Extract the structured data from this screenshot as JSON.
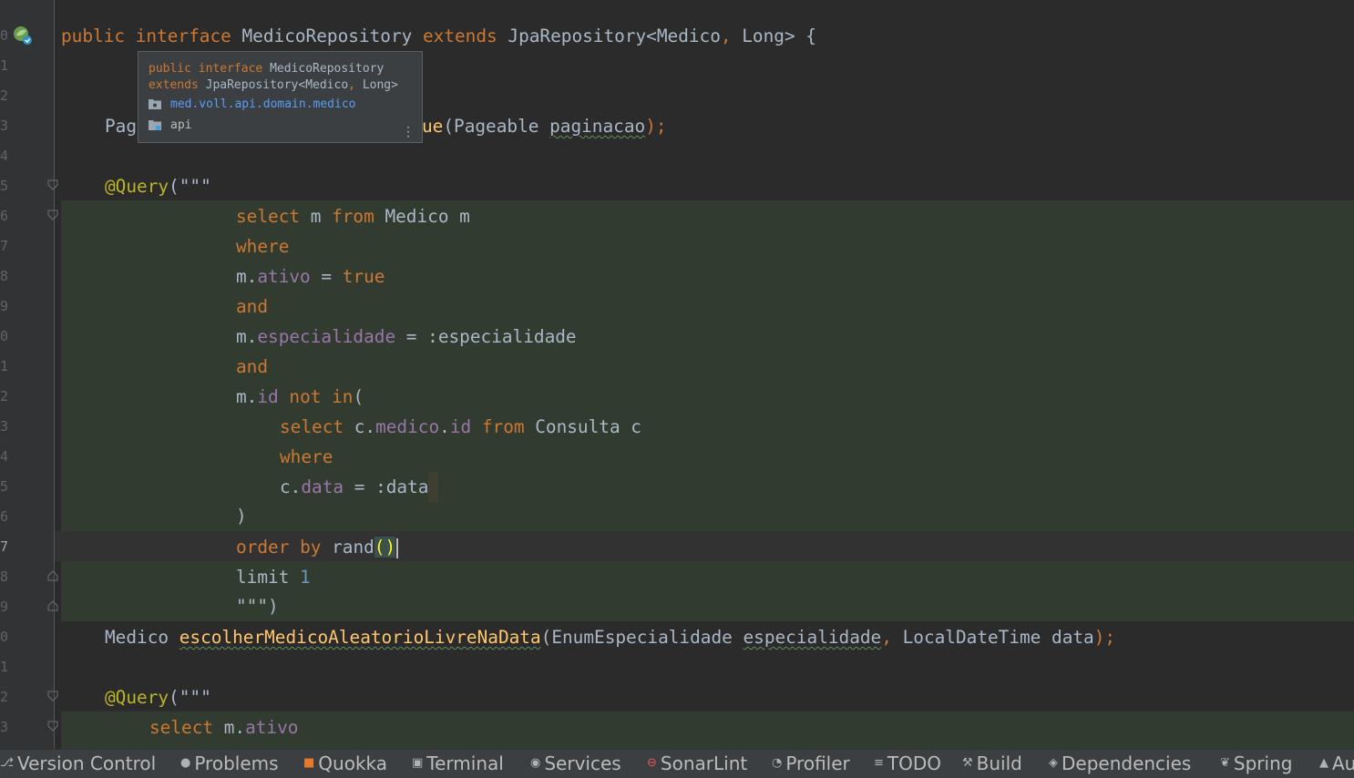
{
  "editor": {
    "line_number_digits": [
      "0",
      "1",
      "2",
      "3",
      "4",
      "5",
      "6",
      "7",
      "8",
      "9",
      "0",
      "1",
      "2",
      "3",
      "4",
      "5",
      "6",
      "7",
      "8",
      "9",
      "0",
      "1",
      "2",
      "3"
    ],
    "current_line_index": 17,
    "tokens": {
      "public": "public",
      "interface": "interface",
      "class_name": "MedicoRepository",
      "extends": "extends",
      "jpa_generic": "JpaRepository<Medico",
      "comma": ", ",
      "long_brace": "Long> {",
      "pag_prefix": "Pag",
      "method1_tail": "ue",
      "paren_pageable": "(Pageable ",
      "paginacao": "paginacao",
      "close_semicolon": ");",
      "query_annotation": "@Query",
      "triple_quote_open": "(\"\"\"",
      "select": "select",
      "m": " m ",
      "from": "from",
      "medico_m": " Medico m",
      "where": "where",
      "m_dot": "m.",
      "ativo": "ativo",
      "eq": " = ",
      "true_kw": "true",
      "and": "and",
      "especialidade_field": "especialidade",
      "especialidade_param": " = :especialidade",
      "id_field": "id",
      "not": " not ",
      "in": "in",
      "open_paren": "(",
      "c_dot": " c.",
      "medico_field": "medico",
      "dot": ".",
      "consulta_c": " Consulta c",
      "c_prefix": "c.",
      "data_field": "data",
      "data_param": " = :data",
      "close_paren": ")",
      "order": "order",
      "by": "by",
      "rand": " rand",
      "rand_parens": "()",
      "limit": "limit ",
      "one": "1",
      "triple_quote_close": "\"\"\")",
      "medico_type": "Medico ",
      "method2": "escolherMedicoAleatorioLivreNaData",
      "enum_param": "(EnumEspecialidade ",
      "especialidade_arg": "especialidade",
      "localdatetime": "LocalDateTime data",
      "select_m_ativo_select": "select",
      "m_ativo_prefix": " m.",
      "ativo2": "ativo"
    }
  },
  "popup": {
    "line1_public": "public",
    "line1_interface": "interface",
    "line1_name": "MedicoRepository",
    "line2_extends": "extends",
    "line2_rest": "JpaRepository<Medico",
    "line2_comma": ", ",
    "line2_long": "Long>",
    "package": "med.voll.api.domain.medico",
    "module": "api",
    "more_glyph": "⋮"
  },
  "toolwindow_bar": {
    "items": [
      {
        "label": "Version Control",
        "icon": "version-control-icon",
        "glyph": "⎇"
      },
      {
        "label": "Problems",
        "icon": "problems-icon",
        "glyph": "●"
      },
      {
        "label": "Quokka",
        "icon": "quokka-icon",
        "glyph": "■"
      },
      {
        "label": "Terminal",
        "icon": "terminal-icon",
        "glyph": "▣"
      },
      {
        "label": "Services",
        "icon": "services-icon",
        "glyph": "◉"
      },
      {
        "label": "SonarLint",
        "icon": "sonarlint-icon",
        "glyph": "⊖"
      },
      {
        "label": "Profiler",
        "icon": "profiler-icon",
        "glyph": "◔"
      },
      {
        "label": "TODO",
        "icon": "todo-icon",
        "glyph": "≡"
      },
      {
        "label": "Build",
        "icon": "build-icon",
        "glyph": "⚒"
      },
      {
        "label": "Dependencies",
        "icon": "dependencies-icon",
        "glyph": "◈"
      },
      {
        "label": "Spring",
        "icon": "spring-icon",
        "glyph": "❦"
      },
      {
        "label": "Au",
        "icon": "auto-build-icon",
        "glyph": "▲"
      }
    ]
  },
  "colors": {
    "background": "#2b2b2b",
    "gutter": "#313335",
    "keyword": "#cc7832",
    "annotation": "#bbb529",
    "field": "#9876aa",
    "number": "#6897bb",
    "injected_bg": "#323b30",
    "toolbar_bg": "#3c3f41"
  }
}
